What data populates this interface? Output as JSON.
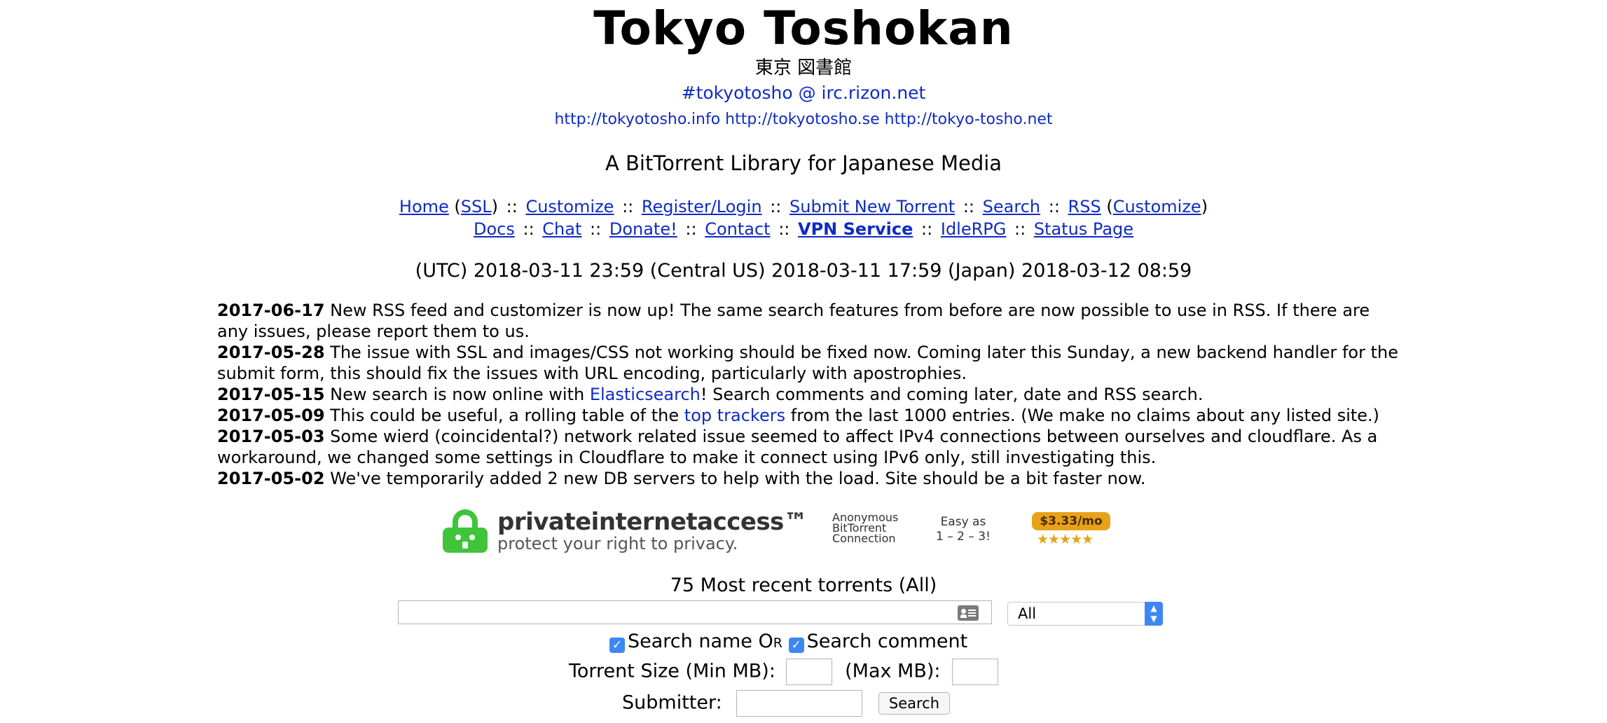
{
  "header": {
    "title": "Tokyo Toshokan",
    "japanese_title": "東京 図書館",
    "irc": "#tokyotosho @ irc.rizon.net",
    "mirrors": "http://tokyotosho.info http://tokyotosho.se http://tokyo-tosho.net",
    "tagline": "A BitTorrent Library for Japanese Media"
  },
  "nav": {
    "home": "Home",
    "ssl": "SSL",
    "customize": "Customize",
    "register": "Register/Login",
    "submit": "Submit New Torrent",
    "search": "Search",
    "rss": "RSS",
    "rss_customize": "Customize",
    "docs": "Docs",
    "chat": "Chat",
    "donate": "Donate!",
    "contact": "Contact",
    "vpn": "VPN Service",
    "idlerpg": "IdleRPG",
    "status": "Status Page",
    "separator": "::"
  },
  "time": "(UTC) 2018-03-11 23:59 (Central US) 2018-03-11 17:59 (Japan) 2018-03-12 08:59",
  "news": [
    {
      "date": "2017-06-17",
      "text": "New RSS feed and customizer is now up! The same search features from before are now possible to use in RSS. If there are any issues, please report them to us."
    },
    {
      "date": "2017-05-28",
      "text": "The issue with SSL and images/CSS not working should be fixed now. Coming later this Sunday, a new backend handler for the submit form, this should fix the issues with URL encoding, particularly with apostrophies."
    },
    {
      "date": "2017-05-15",
      "text_before": "New search is now online with ",
      "link": "Elasticsearch",
      "text_after": "! Search comments and coming later, date and RSS search."
    },
    {
      "date": "2017-05-09",
      "text_before": "This could be useful, a rolling table of the ",
      "link": "top trackers",
      "text_after": " from the last 1000 entries. (We make no claims about any listed site.)"
    },
    {
      "date": "2017-05-03",
      "text": "Some wierd (coincidental?) network related issue seemed to affect IPv4 connections between ourselves and cloudflare. As a workaround, we changed some settings in Cloudflare to make it connect using IPv6 only, still investigating this."
    },
    {
      "date": "2017-05-02",
      "text": "We've temporarily added 2 new DB servers to help with the load. Site should be a bit faster now."
    }
  ],
  "ad": {
    "brand": "privateinternetaccess™",
    "slogan": "protect your right to privacy.",
    "anon_line1": "Anonymous",
    "anon_line2": "BitTorrent",
    "anon_line3": "Connection",
    "easy_line1": "Easy as",
    "easy_line2": "1 – 2 – 3!",
    "price": "$3.33/mo",
    "stars": "★★★★★"
  },
  "search": {
    "recent_label": "75 Most recent torrents (All)",
    "query_value": "",
    "category_selected": "All",
    "search_name_label": "Search name",
    "or_label": "Or",
    "search_comment_label": "Search comment",
    "size_min_label": "Torrent Size (Min MB):",
    "size_max_label": "(Max MB):",
    "submitter_label": "Submitter:",
    "search_button": "Search"
  },
  "colors": {
    "link": "#0f2bc4",
    "checkbox": "#3d87f5",
    "lock_green": "#3fc43a",
    "price_badge": "#e8a21a"
  }
}
